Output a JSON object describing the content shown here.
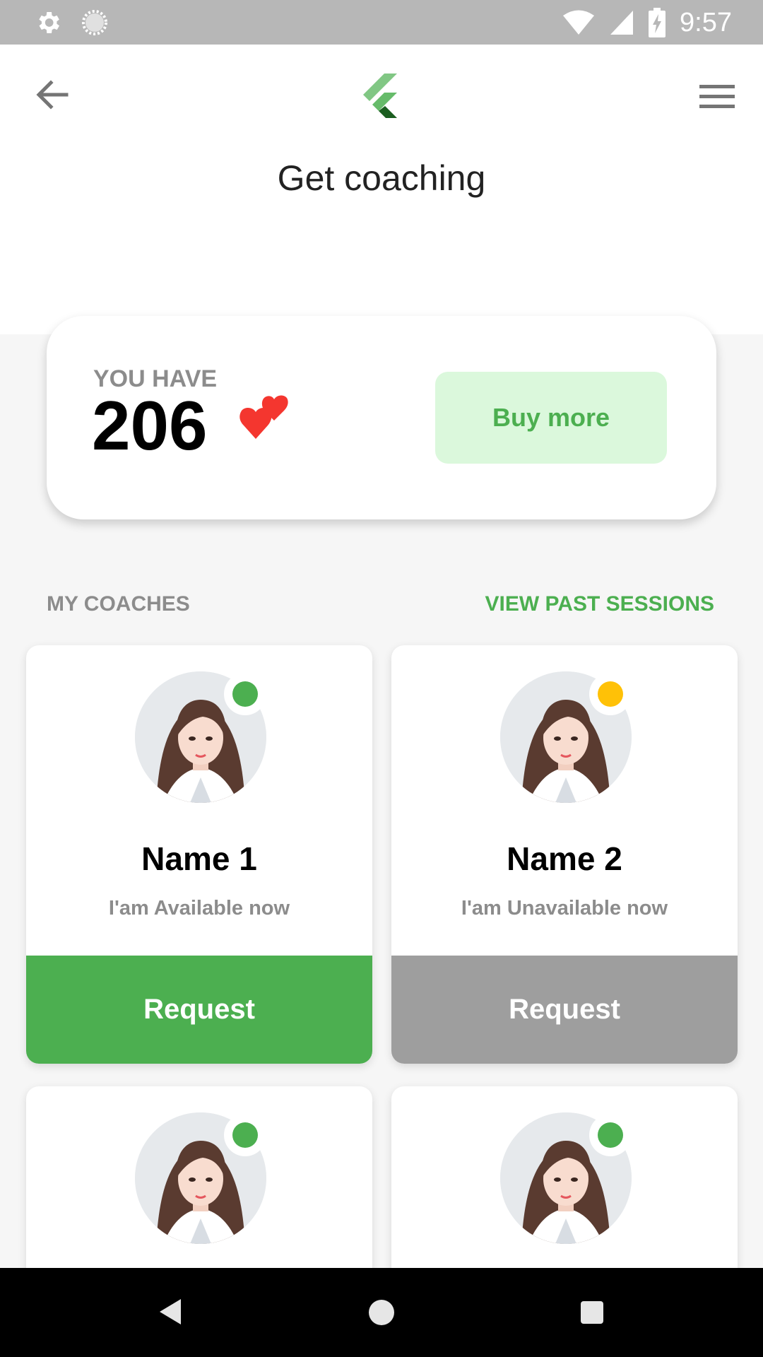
{
  "status_bar": {
    "time": "9:57",
    "icons": [
      "settings-gear-icon",
      "sync-spinner-icon",
      "wifi-icon",
      "cellular-signal-icon",
      "battery-charging-icon"
    ]
  },
  "app_bar": {
    "back_icon": "arrow-left-icon",
    "logo_icon": "flutter-logo-icon",
    "menu_icon": "hamburger-menu-icon"
  },
  "page": {
    "title": "Get coaching"
  },
  "balance": {
    "label": "YOU HAVE",
    "count": "206",
    "icon": "two-hearts-icon",
    "buy_label": "Buy more"
  },
  "coaches_section": {
    "label": "MY COACHES",
    "link": "VIEW PAST SESSIONS"
  },
  "coaches": [
    {
      "name": "Name 1",
      "status": "I'am Available now",
      "indicator_color": "#4caf50",
      "button_label": "Request",
      "button_color": "#4caf50"
    },
    {
      "name": "Name 2",
      "status": "I'am Unavailable now",
      "indicator_color": "#ffc107",
      "button_label": "Request",
      "button_color": "#9e9e9e"
    },
    {
      "name": "",
      "status": "",
      "indicator_color": "#4caf50",
      "button_label": "",
      "button_color": "#4caf50"
    },
    {
      "name": "",
      "status": "",
      "indicator_color": "#4caf50",
      "button_label": "",
      "button_color": "#4caf50"
    }
  ],
  "colors": {
    "accent_green": "#4caf50",
    "buy_more_bg": "#dbf8dc",
    "unavailable_gray": "#9e9e9e",
    "available_dot": "#4caf50",
    "unavailable_dot": "#ffc107"
  },
  "nav_bar": {
    "icons": [
      "nav-back-icon",
      "nav-home-icon",
      "nav-recents-icon"
    ]
  }
}
